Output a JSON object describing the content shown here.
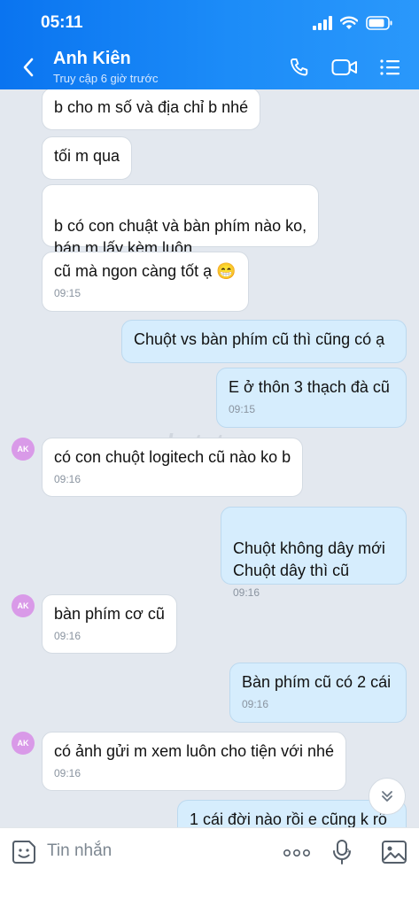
{
  "status_bar": {
    "time": "05:11"
  },
  "header": {
    "name": "Anh Kiên",
    "status": "Truy cập 6 giờ trước"
  },
  "icons": {
    "back": "chevron-left-icon",
    "call": "phone-icon",
    "video": "video-camera-icon",
    "menu": "list-icon"
  },
  "watermark": "nhatot",
  "messages": [
    {
      "dir": "in",
      "text": "b cho m số và địa chỉ b nhé",
      "time": ""
    },
    {
      "dir": "in",
      "text": "tối m qua",
      "time": ""
    },
    {
      "dir": "in",
      "text": "b có con chuật và bàn phím nào ko,\nbán m lấy kèm luôn",
      "time": ""
    },
    {
      "dir": "in",
      "text": "cũ mà ngon càng tốt ạ 😁",
      "time": "09:15"
    },
    {
      "dir": "out",
      "text": "Chuột vs bàn phím cũ thì cũng có ạ",
      "time": ""
    },
    {
      "dir": "out",
      "text": "E ở thôn 3 thạch đà cũ",
      "time": "09:15"
    },
    {
      "dir": "in",
      "avatar": "AK",
      "text": "có con chuột logitech cũ nào ko b",
      "time": "09:16"
    },
    {
      "dir": "out",
      "text": "Chuột không dây mới\nChuột dây thì cũ",
      "time": "09:16"
    },
    {
      "dir": "in",
      "avatar": "AK",
      "text": "bàn phím cơ cũ",
      "time": "09:16"
    },
    {
      "dir": "out",
      "text": "Bàn phím cũ có 2 cái",
      "time": "09:16"
    },
    {
      "dir": "in",
      "avatar": "AK",
      "text": "có ảnh gửi m xem luôn cho tiện với nhé",
      "time": "09:16"
    },
    {
      "dir": "out",
      "text": "1 cái đời nào rồi e cũng k rõ",
      "time": ""
    }
  ],
  "composer": {
    "placeholder": "Tin nhắn"
  }
}
